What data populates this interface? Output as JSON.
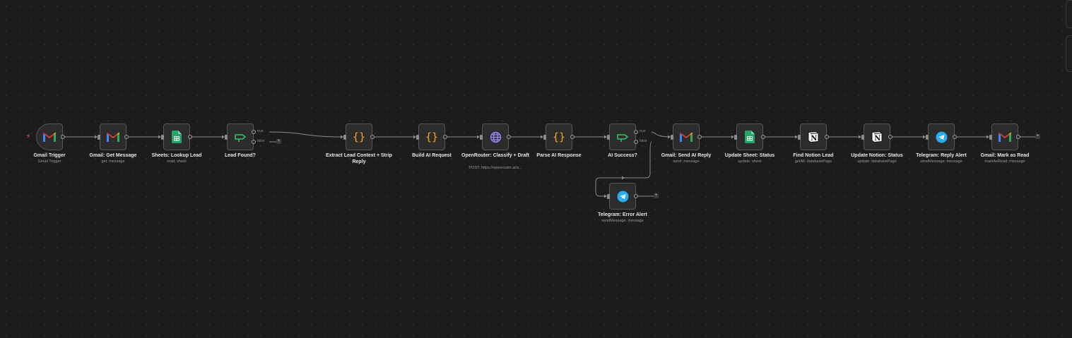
{
  "workflow": {
    "nodes": [
      {
        "id": "gmail-trigger",
        "title": "Gmail Trigger",
        "subtitle": "Gmail Trigger",
        "icon": "gmail-icon",
        "trigger": true
      },
      {
        "id": "gmail-get-message",
        "title": "Gmail: Get Message",
        "subtitle": "get: message",
        "icon": "gmail-icon"
      },
      {
        "id": "sheets-lookup-lead",
        "title": "Sheets: Lookup Lead",
        "subtitle": "read: sheet",
        "icon": "google-sheets-icon"
      },
      {
        "id": "lead-found",
        "title": "Lead Found?",
        "subtitle": "",
        "icon": "if-branch-icon",
        "branches": [
          "true",
          "false"
        ]
      },
      {
        "id": "extract-lead-context",
        "title": "Extract Lead Context + Strip Reply",
        "subtitle": "",
        "icon": "code-braces-icon"
      },
      {
        "id": "build-ai-request",
        "title": "Build AI Request",
        "subtitle": "",
        "icon": "code-braces-icon"
      },
      {
        "id": "openrouter-classify",
        "title": "OpenRouter: Classify + Draft",
        "subtitle": "POST: https://openrouter.ai/a...",
        "icon": "globe-icon"
      },
      {
        "id": "parse-ai-response",
        "title": "Parse AI Response",
        "subtitle": "",
        "icon": "code-braces-icon"
      },
      {
        "id": "ai-success",
        "title": "AI Success?",
        "subtitle": "",
        "icon": "if-branch-icon",
        "branches": [
          "true",
          "false"
        ]
      },
      {
        "id": "gmail-send-ai-reply",
        "title": "Gmail: Send AI Reply",
        "subtitle": "send: message",
        "icon": "gmail-icon"
      },
      {
        "id": "update-sheet-status",
        "title": "Update Sheet: Status",
        "subtitle": "update: sheet",
        "icon": "google-sheets-icon"
      },
      {
        "id": "find-notion-lead",
        "title": "Find Notion Lead",
        "subtitle": "getAll: databasePage",
        "icon": "notion-icon"
      },
      {
        "id": "update-notion-status",
        "title": "Update Notion: Status",
        "subtitle": "update: databasePage",
        "icon": "notion-icon"
      },
      {
        "id": "telegram-reply-alert",
        "title": "Telegram: Reply Alert",
        "subtitle": "sendMessage: message",
        "icon": "telegram-icon"
      },
      {
        "id": "gmail-mark-as-read",
        "title": "Gmail: Mark as Read",
        "subtitle": "markAsRead: message",
        "icon": "gmail-icon"
      },
      {
        "id": "telegram-error-alert",
        "title": "Telegram: Error Alert",
        "subtitle": "sendMessage: message",
        "icon": "telegram-icon"
      }
    ],
    "plus_symbol": "+"
  },
  "colors": {
    "canvas_bg": "#1c1c1c",
    "node_bg": "#2c2c2c",
    "node_border": "#575757",
    "edge": "#8a8a8a",
    "trigger_bolt": "#ff6d5a",
    "code_orange": "#f5a623",
    "if_green": "#35c26b",
    "globe_purple": "#9b8cff",
    "telegram_blue": "#2aabee"
  }
}
